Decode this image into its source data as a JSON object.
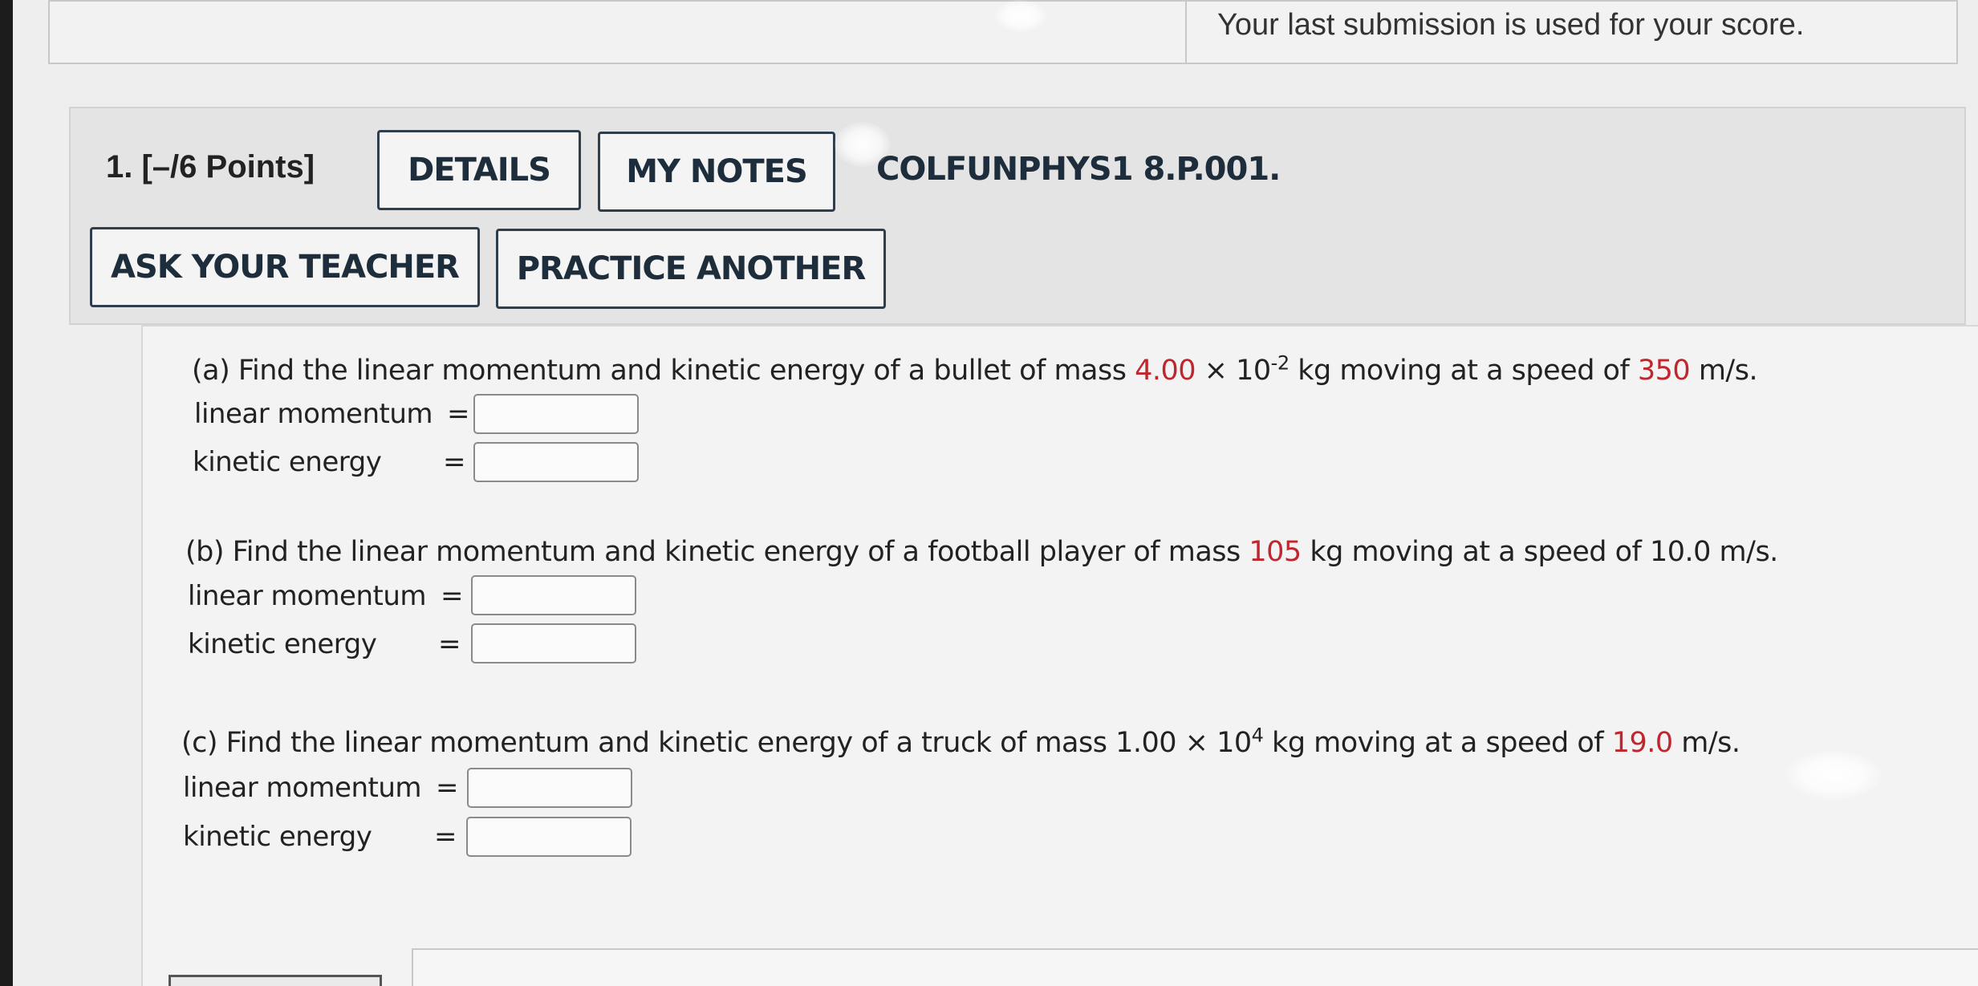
{
  "header": {
    "notice": "Your last submission is used for your score."
  },
  "question": {
    "number_points": "1.  [–/6 Points]",
    "details_button": "DETAILS",
    "my_notes_button": "MY NOTES",
    "code": "COLFUNPHYS1 8.P.001.",
    "ask_teacher_button": "ASK YOUR TEACHER",
    "practice_another_button": "PRACTICE ANOTHER"
  },
  "parts": {
    "a": {
      "prefix": "(a) Find the linear momentum and kinetic energy of a bullet of mass ",
      "mass_mantissa": "4.00",
      "times": " × 10",
      "exponent": "-2",
      "mid": " kg moving at a speed of ",
      "speed": "350",
      "suffix": " m/s.",
      "momentum_label": "linear momentum",
      "energy_label": "kinetic energy",
      "equals": "="
    },
    "b": {
      "prefix": "(b) Find the linear momentum and kinetic energy of a football player of mass ",
      "mass": "105",
      "mid": " kg moving at a speed of 10.0 m/s.",
      "momentum_label": "linear momentum",
      "energy_label": "kinetic energy",
      "equals": "="
    },
    "c": {
      "prefix": "(c) Find the linear momentum and kinetic energy of a truck of mass 1.00 × 10",
      "exponent": "4",
      "mid": " kg moving at a speed of ",
      "speed": "19.0",
      "suffix": " m/s.",
      "momentum_label": "linear momentum",
      "energy_label": "kinetic energy",
      "equals": "="
    }
  },
  "answers": {
    "a_momentum": "",
    "a_energy": "",
    "b_momentum": "",
    "b_energy": "",
    "c_momentum": "",
    "c_energy": ""
  },
  "colors": {
    "highlight": "#c0262d",
    "button_border": "#2f3e4d"
  }
}
